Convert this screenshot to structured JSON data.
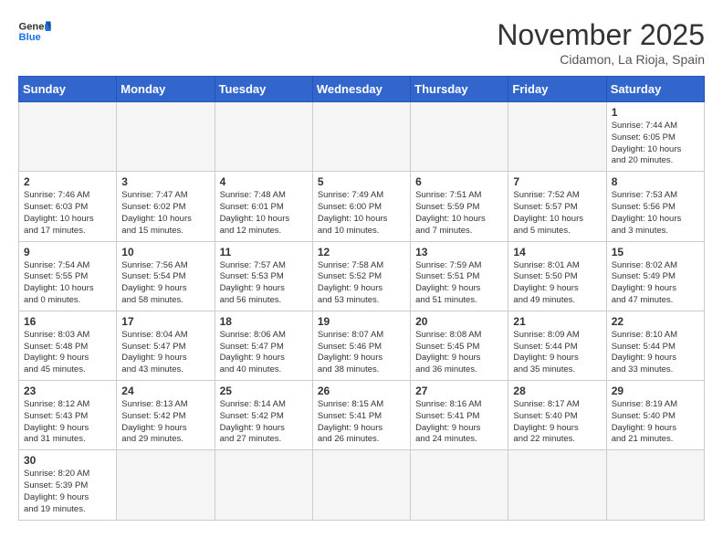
{
  "logo": {
    "text_general": "General",
    "text_blue": "Blue"
  },
  "title": "November 2025",
  "subtitle": "Cidamon, La Rioja, Spain",
  "weekdays": [
    "Sunday",
    "Monday",
    "Tuesday",
    "Wednesday",
    "Thursday",
    "Friday",
    "Saturday"
  ],
  "weeks": [
    [
      {
        "day": "",
        "info": ""
      },
      {
        "day": "",
        "info": ""
      },
      {
        "day": "",
        "info": ""
      },
      {
        "day": "",
        "info": ""
      },
      {
        "day": "",
        "info": ""
      },
      {
        "day": "",
        "info": ""
      },
      {
        "day": "1",
        "info": "Sunrise: 7:44 AM\nSunset: 6:05 PM\nDaylight: 10 hours\nand 20 minutes."
      }
    ],
    [
      {
        "day": "2",
        "info": "Sunrise: 7:46 AM\nSunset: 6:03 PM\nDaylight: 10 hours\nand 17 minutes."
      },
      {
        "day": "3",
        "info": "Sunrise: 7:47 AM\nSunset: 6:02 PM\nDaylight: 10 hours\nand 15 minutes."
      },
      {
        "day": "4",
        "info": "Sunrise: 7:48 AM\nSunset: 6:01 PM\nDaylight: 10 hours\nand 12 minutes."
      },
      {
        "day": "5",
        "info": "Sunrise: 7:49 AM\nSunset: 6:00 PM\nDaylight: 10 hours\nand 10 minutes."
      },
      {
        "day": "6",
        "info": "Sunrise: 7:51 AM\nSunset: 5:59 PM\nDaylight: 10 hours\nand 7 minutes."
      },
      {
        "day": "7",
        "info": "Sunrise: 7:52 AM\nSunset: 5:57 PM\nDaylight: 10 hours\nand 5 minutes."
      },
      {
        "day": "8",
        "info": "Sunrise: 7:53 AM\nSunset: 5:56 PM\nDaylight: 10 hours\nand 3 minutes."
      }
    ],
    [
      {
        "day": "9",
        "info": "Sunrise: 7:54 AM\nSunset: 5:55 PM\nDaylight: 10 hours\nand 0 minutes."
      },
      {
        "day": "10",
        "info": "Sunrise: 7:56 AM\nSunset: 5:54 PM\nDaylight: 9 hours\nand 58 minutes."
      },
      {
        "day": "11",
        "info": "Sunrise: 7:57 AM\nSunset: 5:53 PM\nDaylight: 9 hours\nand 56 minutes."
      },
      {
        "day": "12",
        "info": "Sunrise: 7:58 AM\nSunset: 5:52 PM\nDaylight: 9 hours\nand 53 minutes."
      },
      {
        "day": "13",
        "info": "Sunrise: 7:59 AM\nSunset: 5:51 PM\nDaylight: 9 hours\nand 51 minutes."
      },
      {
        "day": "14",
        "info": "Sunrise: 8:01 AM\nSunset: 5:50 PM\nDaylight: 9 hours\nand 49 minutes."
      },
      {
        "day": "15",
        "info": "Sunrise: 8:02 AM\nSunset: 5:49 PM\nDaylight: 9 hours\nand 47 minutes."
      }
    ],
    [
      {
        "day": "16",
        "info": "Sunrise: 8:03 AM\nSunset: 5:48 PM\nDaylight: 9 hours\nand 45 minutes."
      },
      {
        "day": "17",
        "info": "Sunrise: 8:04 AM\nSunset: 5:47 PM\nDaylight: 9 hours\nand 43 minutes."
      },
      {
        "day": "18",
        "info": "Sunrise: 8:06 AM\nSunset: 5:47 PM\nDaylight: 9 hours\nand 40 minutes."
      },
      {
        "day": "19",
        "info": "Sunrise: 8:07 AM\nSunset: 5:46 PM\nDaylight: 9 hours\nand 38 minutes."
      },
      {
        "day": "20",
        "info": "Sunrise: 8:08 AM\nSunset: 5:45 PM\nDaylight: 9 hours\nand 36 minutes."
      },
      {
        "day": "21",
        "info": "Sunrise: 8:09 AM\nSunset: 5:44 PM\nDaylight: 9 hours\nand 35 minutes."
      },
      {
        "day": "22",
        "info": "Sunrise: 8:10 AM\nSunset: 5:44 PM\nDaylight: 9 hours\nand 33 minutes."
      }
    ],
    [
      {
        "day": "23",
        "info": "Sunrise: 8:12 AM\nSunset: 5:43 PM\nDaylight: 9 hours\nand 31 minutes."
      },
      {
        "day": "24",
        "info": "Sunrise: 8:13 AM\nSunset: 5:42 PM\nDaylight: 9 hours\nand 29 minutes."
      },
      {
        "day": "25",
        "info": "Sunrise: 8:14 AM\nSunset: 5:42 PM\nDaylight: 9 hours\nand 27 minutes."
      },
      {
        "day": "26",
        "info": "Sunrise: 8:15 AM\nSunset: 5:41 PM\nDaylight: 9 hours\nand 26 minutes."
      },
      {
        "day": "27",
        "info": "Sunrise: 8:16 AM\nSunset: 5:41 PM\nDaylight: 9 hours\nand 24 minutes."
      },
      {
        "day": "28",
        "info": "Sunrise: 8:17 AM\nSunset: 5:40 PM\nDaylight: 9 hours\nand 22 minutes."
      },
      {
        "day": "29",
        "info": "Sunrise: 8:19 AM\nSunset: 5:40 PM\nDaylight: 9 hours\nand 21 minutes."
      }
    ],
    [
      {
        "day": "30",
        "info": "Sunrise: 8:20 AM\nSunset: 5:39 PM\nDaylight: 9 hours\nand 19 minutes."
      },
      {
        "day": "",
        "info": ""
      },
      {
        "day": "",
        "info": ""
      },
      {
        "day": "",
        "info": ""
      },
      {
        "day": "",
        "info": ""
      },
      {
        "day": "",
        "info": ""
      },
      {
        "day": "",
        "info": ""
      }
    ]
  ]
}
